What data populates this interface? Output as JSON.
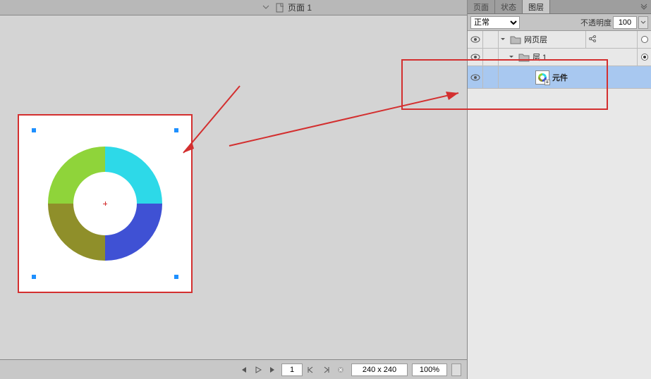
{
  "tabs": {
    "page_title": "页面 1"
  },
  "panel": {
    "tabs": {
      "t1": "页面",
      "t2": "状态",
      "t3": "图层"
    },
    "blend_mode": "正常",
    "opacity_label": "不透明度",
    "opacity_value": "100"
  },
  "layers": {
    "web_layer": "网页层",
    "layer1": "层 1",
    "element": "元件"
  },
  "status": {
    "frame": "1",
    "dimensions": "240 x 240",
    "zoom": "100%"
  },
  "chart_data": {
    "type": "pie",
    "title": "",
    "series": [
      {
        "name": "segment-tl",
        "value": 25,
        "color": "#8fd43a"
      },
      {
        "name": "segment-tr",
        "value": 25,
        "color": "#2dd9e8"
      },
      {
        "name": "segment-br",
        "value": 25,
        "color": "#3f51d4"
      },
      {
        "name": "segment-bl",
        "value": 25,
        "color": "#8f8f2a"
      }
    ],
    "inner_radius_ratio": 0.55
  }
}
